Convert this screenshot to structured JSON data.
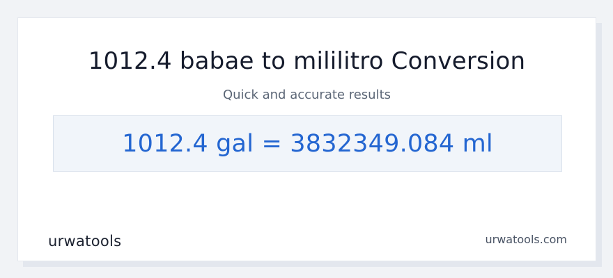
{
  "title": "1012.4 babae to mililitro Conversion",
  "subtitle": "Quick and accurate results",
  "result": "1012.4 gal = 3832349.084 ml",
  "logo": {
    "part1": "urwat",
    "part2": "ools",
    "accent_color": "#2466d1"
  },
  "site_url": "urwatools.com"
}
